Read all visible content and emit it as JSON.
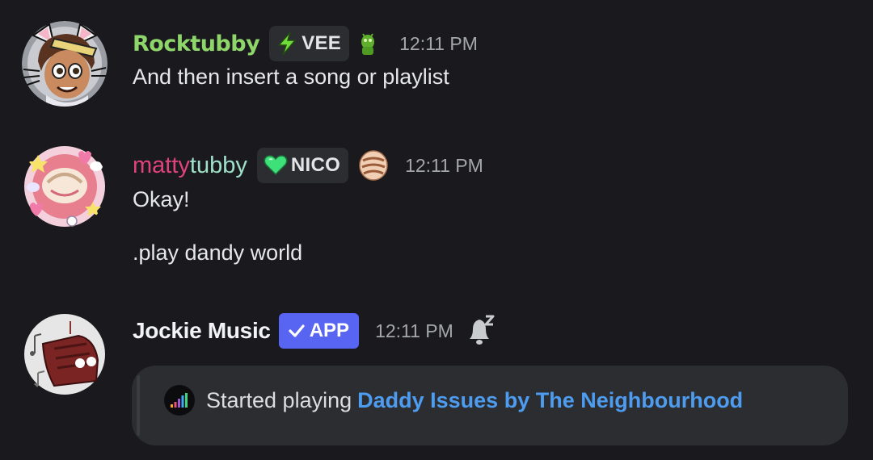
{
  "messages": [
    {
      "username": "Rocktubby",
      "tag": "VEE",
      "tag_icon": "lightning-icon",
      "deco_icon": "green-creature-icon",
      "timestamp": "12:11 PM",
      "lines": [
        "And then insert a song or playlist"
      ],
      "username_color": "#8fd66a"
    },
    {
      "username_part1": "matty",
      "username_part2": "tubby",
      "tag": "NICO",
      "tag_icon": "green-heart-icon",
      "deco_icon": "cinnamon-roll-icon",
      "timestamp": "12:11 PM",
      "lines": [
        "Okay!",
        ".play dandy world"
      ],
      "username_color_1": "#e0427e",
      "username_color_2": "#9fe0c8"
    },
    {
      "username": "Jockie Music",
      "badge": "APP",
      "timestamp": "12:11 PM",
      "status_icon": "bell-sleep-icon",
      "embed": {
        "icon": "music-equalizer-icon",
        "text": "Started playing",
        "link": "Daddy Issues by The Neighbourhood"
      },
      "username_color": "#f2f3f5"
    }
  ],
  "colors": {
    "background": "#1a1a1e",
    "embed_background": "#2b2d31",
    "link": "#4d9cf0",
    "app_badge": "#5865f2",
    "timestamp": "#a3a6aa"
  }
}
